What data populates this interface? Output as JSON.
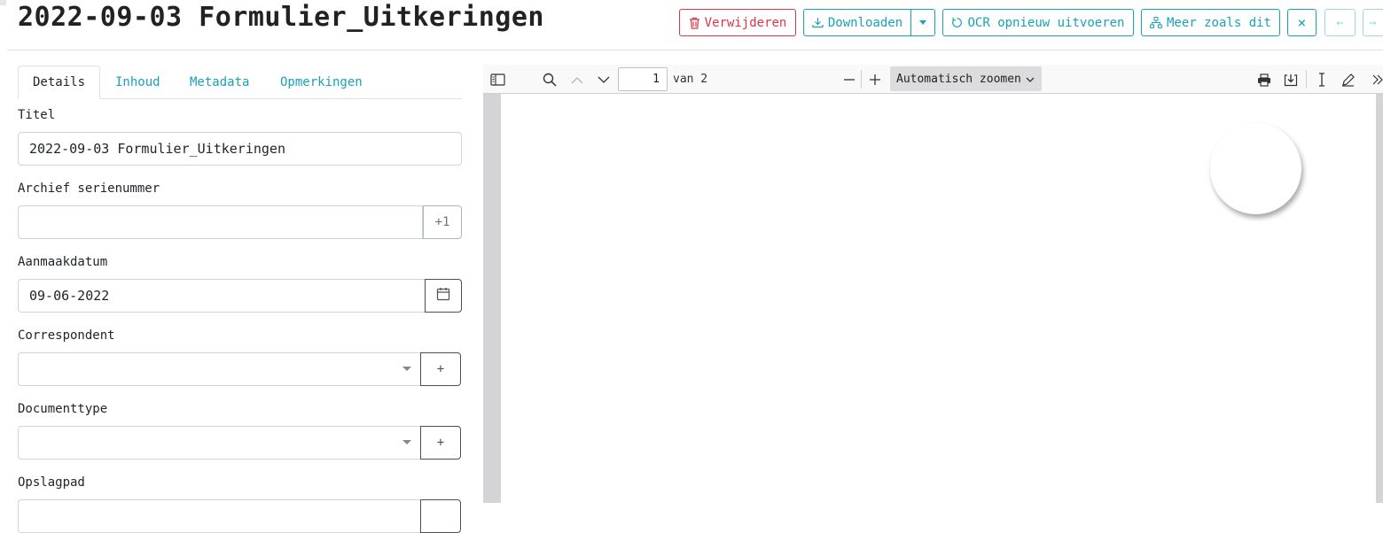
{
  "document": {
    "title": "2022-09-03 Formulier_Uitkeringen"
  },
  "actions": {
    "delete_label": "Verwijderen",
    "download_label": "Downloaden",
    "ocr_label": "OCR opnieuw uitvoeren",
    "more_like_label": "Meer zoals dit",
    "close_label": "×",
    "prev_label": "←",
    "next_label": "→"
  },
  "tabs": [
    {
      "label": "Details",
      "active": true
    },
    {
      "label": "Inhoud",
      "active": false
    },
    {
      "label": "Metadata",
      "active": false
    },
    {
      "label": "Opmerkingen",
      "active": false
    }
  ],
  "form": {
    "title": {
      "label": "Titel",
      "value": "2022-09-03 Formulier_Uitkeringen"
    },
    "asn": {
      "label": "Archief serienummer",
      "value": "",
      "increment_label": "+1"
    },
    "created": {
      "label": "Aanmaakdatum",
      "value": "09-06-2022"
    },
    "correspondent": {
      "label": "Correspondent",
      "value": "",
      "add_label": "+"
    },
    "document_type": {
      "label": "Documenttype",
      "value": "",
      "add_label": "+"
    },
    "storage_path": {
      "label": "Opslagpad"
    }
  },
  "viewer": {
    "page_number": "1",
    "page_count_text": "van 2",
    "zoom_label": "Automatisch zoomen"
  },
  "colors": {
    "accent": "#17a2b8",
    "danger": "#dc3545"
  }
}
